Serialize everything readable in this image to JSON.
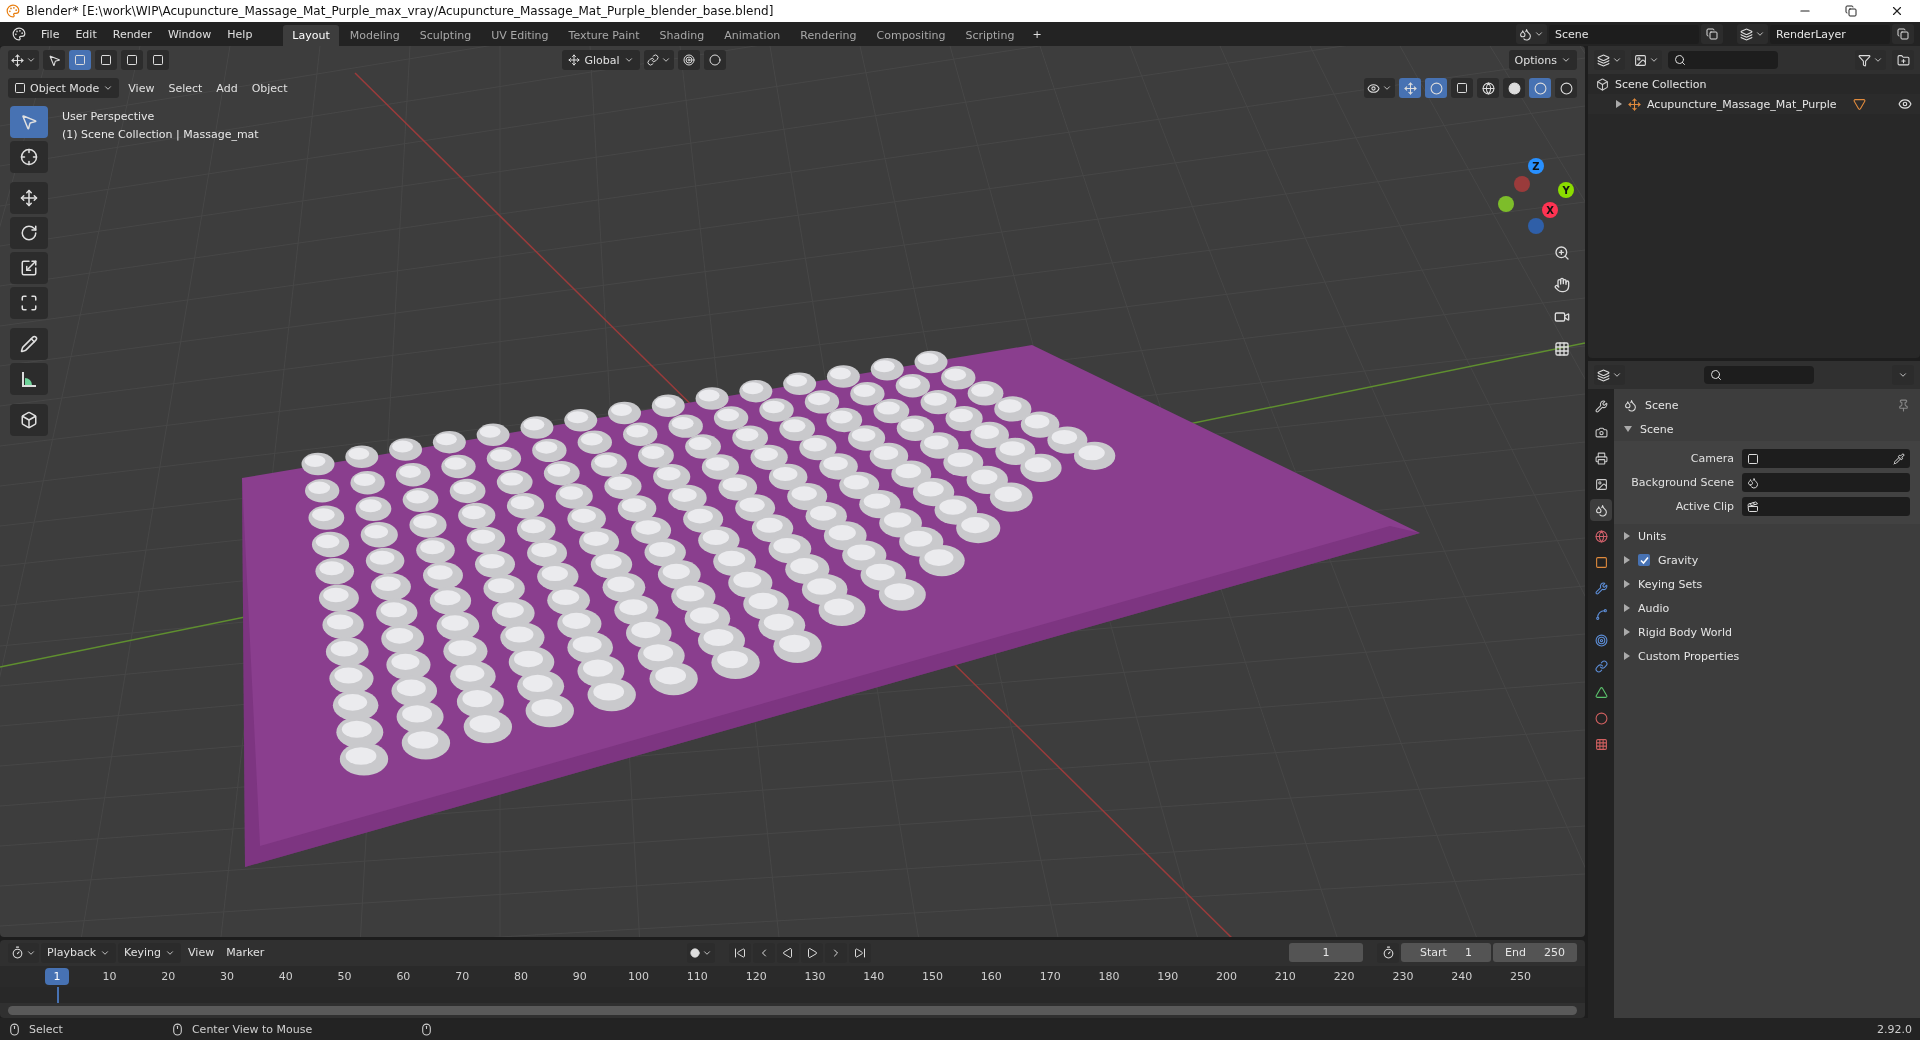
{
  "window": {
    "title": "Blender* [E:\\work\\WIP\\Acupuncture_Massage_Mat_Purple_max_vray/Acupuncture_Massage_Mat_Purple_blender_base.blend]"
  },
  "menus": [
    "File",
    "Edit",
    "Render",
    "Window",
    "Help"
  ],
  "workspaces": [
    {
      "label": "Layout",
      "selected": true
    },
    {
      "label": "Modeling",
      "selected": false
    },
    {
      "label": "Sculpting",
      "selected": false
    },
    {
      "label": "UV Editing",
      "selected": false
    },
    {
      "label": "Texture Paint",
      "selected": false
    },
    {
      "label": "Shading",
      "selected": false
    },
    {
      "label": "Animation",
      "selected": false
    },
    {
      "label": "Rendering",
      "selected": false
    },
    {
      "label": "Compositing",
      "selected": false
    },
    {
      "label": "Scripting",
      "selected": false
    }
  ],
  "add_workspace": "+",
  "scene": "Scene",
  "view_layer": "RenderLayer",
  "viewport": {
    "orientation": "Global",
    "options": "Options",
    "mode": "Object Mode",
    "menus": [
      "View",
      "Select",
      "Add",
      "Object"
    ],
    "overlay_text": [
      "User Perspective",
      "(1) Scene Collection | Massage_mat"
    ],
    "gizmo_axes": [
      "X",
      "Y",
      "Z"
    ],
    "tools": [
      {
        "kind": "select",
        "selected": true
      },
      {
        "kind": "cursor",
        "selected": false
      },
      {
        "kind": "move",
        "selected": false
      },
      {
        "kind": "rotate",
        "selected": false
      },
      {
        "kind": "scale",
        "selected": false
      },
      {
        "kind": "transform",
        "selected": false
      },
      {
        "kind": "annotate",
        "selected": false
      },
      {
        "kind": "measure",
        "selected": false
      },
      {
        "kind": "add-cube",
        "selected": false
      }
    ]
  },
  "outliner": {
    "root": "Scene Collection",
    "items": [
      {
        "label": "Acupuncture_Massage_Mat_Purple",
        "expanded": false,
        "visible": true
      }
    ]
  },
  "properties": {
    "tabs": [
      {
        "kind": "tool",
        "selected": false
      },
      {
        "kind": "render",
        "selected": false
      },
      {
        "kind": "output",
        "selected": false
      },
      {
        "kind": "view-layer",
        "selected": false
      },
      {
        "kind": "scene",
        "selected": true
      },
      {
        "kind": "world",
        "selected": false
      },
      {
        "kind": "object",
        "selected": false
      },
      {
        "kind": "modifier",
        "selected": false
      },
      {
        "kind": "particles",
        "selected": false
      },
      {
        "kind": "physics",
        "selected": false
      },
      {
        "kind": "constraints",
        "selected": false
      },
      {
        "kind": "data",
        "selected": false
      },
      {
        "kind": "material",
        "selected": false
      },
      {
        "kind": "texture",
        "selected": false
      }
    ],
    "header": "Scene",
    "section": {
      "label": "Scene",
      "expanded": true
    },
    "fields": [
      {
        "label": "Camera",
        "kind": "camera"
      },
      {
        "label": "Background Scene",
        "kind": "scene"
      },
      {
        "label": "Active Clip",
        "kind": "clip"
      }
    ],
    "panels": [
      {
        "label": "Units",
        "kind": "plain",
        "expanded": false
      },
      {
        "label": "Gravity",
        "kind": "checkbox",
        "expanded": false,
        "checked": true
      },
      {
        "label": "Keying Sets",
        "kind": "plain",
        "expanded": false
      },
      {
        "label": "Audio",
        "kind": "plain",
        "expanded": false
      },
      {
        "label": "Rigid Body World",
        "kind": "plain",
        "expanded": false
      },
      {
        "label": "Custom Properties",
        "kind": "plain",
        "expanded": false
      }
    ]
  },
  "timeline": {
    "menus": [
      "Playback",
      "Keying",
      "View",
      "Marker"
    ],
    "current_frame": "1",
    "start_label": "Start",
    "start": "1",
    "end_label": "End",
    "end": "250",
    "playhead": "1",
    "ruler": [
      "10",
      "20",
      "30",
      "40",
      "50",
      "60",
      "70",
      "80",
      "90",
      "100",
      "110",
      "120",
      "130",
      "140",
      "150",
      "160",
      "170",
      "180",
      "190",
      "200",
      "210",
      "220",
      "230",
      "240",
      "250"
    ]
  },
  "status_bar": {
    "items": [
      "Select",
      "Center View to Mouse"
    ],
    "version": "2.92.0"
  }
}
